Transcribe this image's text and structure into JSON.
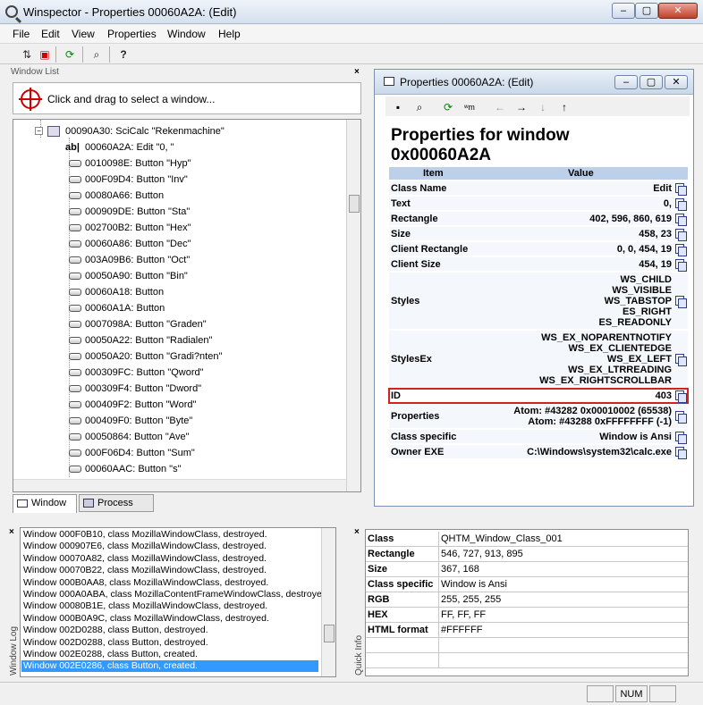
{
  "window": {
    "title": "Winspector - Properties 00060A2A: (Edit)"
  },
  "menu": [
    "File",
    "Edit",
    "View",
    "Properties",
    "Window",
    "Help"
  ],
  "window_list": {
    "header": "Window List",
    "drag_hint": "Click and drag to select a window...",
    "root": "00090A30: SciCalc  \"Rekenmachine\"",
    "selected": "00060A2A: Edit  \"0, \"",
    "items": [
      "0010098E: Button  \"Hyp\"",
      "000F09D4: Button  \"Inv\"",
      "00080A66: Button",
      "000909DE: Button  \"Sta\"",
      "002700B2: Button  \"Hex\"",
      "00060A86: Button  \"Dec\"",
      "003A09B6: Button  \"Oct\"",
      "00050A90: Button  \"Bin\"",
      "00060A18: Button",
      "00060A1A: Button",
      "0007098A: Button  \"Graden\"",
      "00050A22: Button  \"Radialen\"",
      "00050A20: Button  \"Gradi?nten\"",
      "000309FC: Button  \"Qword\"",
      "000309F4: Button  \"Dword\"",
      "000409F2: Button  \"Word\"",
      "000409F0: Button  \"Byte\"",
      "00050864: Button  \"Ave\"",
      "000F06D4: Button  \"Sum\"",
      "00060AAC: Button  \"s\""
    ],
    "tabs": [
      "Window",
      "Process"
    ]
  },
  "properties": {
    "title": "Properties 00060A2A: (Edit)",
    "heading_line1": "Properties for window",
    "heading_line2": "0x00060A2A",
    "col_item": "Item",
    "col_value": "Value",
    "rows": [
      {
        "label": "Class Name",
        "value": [
          "Edit"
        ]
      },
      {
        "label": "Text",
        "value": [
          "0,"
        ]
      },
      {
        "label": "Rectangle",
        "value": [
          "402, 596, 860, 619"
        ]
      },
      {
        "label": "Size",
        "value": [
          "458, 23"
        ]
      },
      {
        "label": "Client Rectangle",
        "value": [
          "0, 0, 454, 19"
        ]
      },
      {
        "label": "Client Size",
        "value": [
          "454, 19"
        ]
      },
      {
        "label": "Styles",
        "value": [
          "WS_CHILD",
          "WS_VISIBLE",
          "WS_TABSTOP",
          "ES_RIGHT",
          "ES_READONLY"
        ]
      },
      {
        "label": "StylesEx",
        "value": [
          "WS_EX_NOPARENTNOTIFY",
          "WS_EX_CLIENTEDGE",
          "WS_EX_LEFT",
          "WS_EX_LTRREADING",
          "WS_EX_RIGHTSCROLLBAR"
        ]
      },
      {
        "label": "ID",
        "value": [
          "403"
        ]
      },
      {
        "label": "Properties",
        "value": [
          "Atom: #43282 0x00010002 (65538)",
          "Atom: #43288 0xFFFFFFFF (-1)"
        ]
      },
      {
        "label": "Class specific",
        "value": [
          "Window is Ansi"
        ]
      },
      {
        "label": "Owner EXE",
        "value": [
          "C:\\Windows\\system32\\calc.exe"
        ]
      }
    ]
  },
  "window_log": {
    "label": "Window Log",
    "lines": [
      "Window 000F0B10, class MozillaWindowClass, destroyed.",
      "Window 000907E6, class MozillaWindowClass, destroyed.",
      "Window 00070A82, class MozillaWindowClass, destroyed.",
      "Window 00070B22, class MozillaWindowClass, destroyed.",
      "Window 000B0AA8, class MozillaWindowClass, destroyed.",
      "Window 000A0ABA, class MozillaContentFrameWindowClass, destroye",
      "Window 00080B1E, class MozillaWindowClass, destroyed.",
      "Window 000B0A9C, class MozillaWindowClass, destroyed.",
      "Window 002D0288, class Button, destroyed.",
      "Window 002D0288, class Button, destroyed.",
      "Window 002E0288, class Button, created.",
      "Window 002E0286, class Button, created."
    ]
  },
  "quick_info": {
    "label": "Quick Info",
    "rows": [
      {
        "k": "Class",
        "v": "QHTM_Window_Class_001"
      },
      {
        "k": "Rectangle",
        "v": "546, 727, 913, 895"
      },
      {
        "k": "Size",
        "v": "367, 168"
      },
      {
        "k": "Class specific",
        "v": "Window is Ansi"
      },
      {
        "k": "RGB",
        "v": "255, 255, 255"
      },
      {
        "k": "HEX",
        "v": "FF, FF, FF"
      },
      {
        "k": "HTML format",
        "v": "#FFFFFF"
      }
    ]
  },
  "status": {
    "num": "NUM"
  }
}
